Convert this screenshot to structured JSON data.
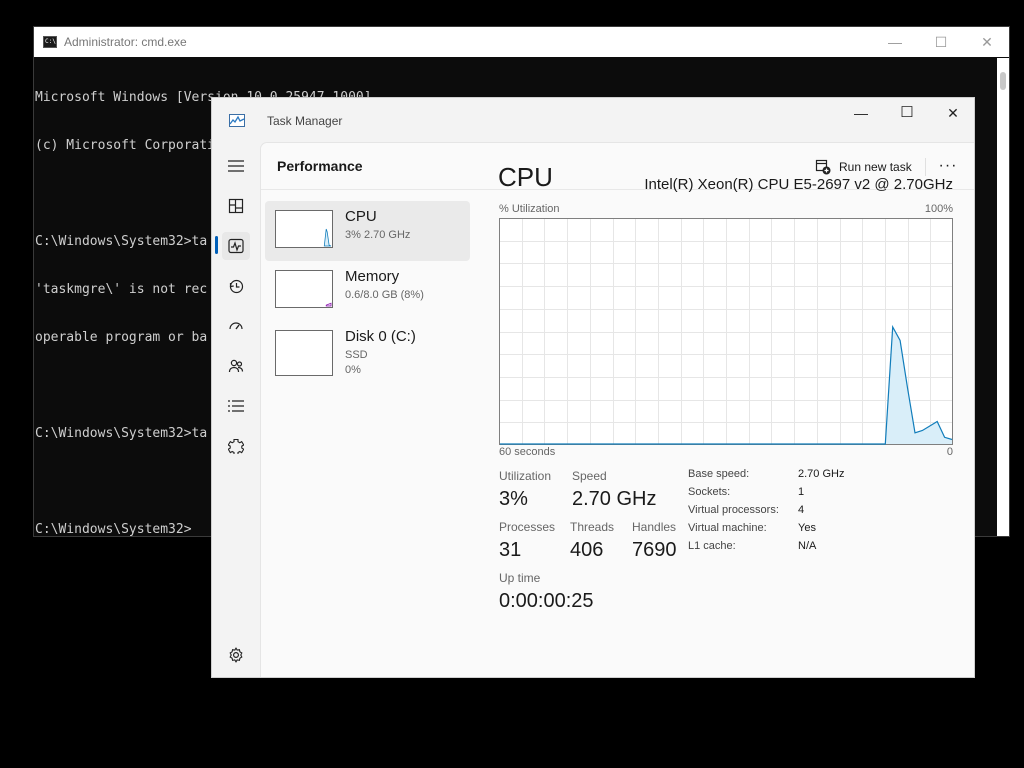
{
  "cmd": {
    "title": "Administrator: cmd.exe",
    "icon_text": "C:\\",
    "controls": {
      "minimize": "—",
      "maximize": "☐",
      "close": "✕"
    },
    "lines": [
      "Microsoft Windows [Version 10.0.25947.1000]",
      "(c) Microsoft Corporation. All rights reserved.",
      "",
      "C:\\Windows\\System32>ta",
      "'taskmgre\\' is not rec",
      "operable program or ba",
      "",
      "C:\\Windows\\System32>ta",
      "",
      "C:\\Windows\\System32>"
    ]
  },
  "taskmanager": {
    "title": "Task Manager",
    "controls": {
      "minimize": "—",
      "maximize": "☐",
      "close": "✕"
    },
    "header": {
      "page_title": "Performance",
      "run_new_task": "Run new task",
      "more": "···"
    },
    "rail": [
      {
        "name": "hamburger-menu-icon",
        "active": false
      },
      {
        "name": "processes-icon",
        "active": false
      },
      {
        "name": "performance-icon",
        "active": true
      },
      {
        "name": "app-history-icon",
        "active": false
      },
      {
        "name": "startup-apps-icon",
        "active": false
      },
      {
        "name": "users-icon",
        "active": false
      },
      {
        "name": "details-icon",
        "active": false
      },
      {
        "name": "services-icon",
        "active": false
      },
      {
        "name": "settings-icon",
        "active": false
      }
    ],
    "side_items": [
      {
        "name": "CPU",
        "sub1": "3% 2.70 GHz",
        "sub2": "",
        "selected": true
      },
      {
        "name": "Memory",
        "sub1": "0.6/8.0 GB (8%)",
        "sub2": "",
        "selected": false
      },
      {
        "name": "Disk 0 (C:)",
        "sub1": "SSD",
        "sub2": "0%",
        "selected": false
      }
    ],
    "cpu": {
      "heading": "CPU",
      "model": "Intel(R) Xeon(R) CPU E5-2697 v2 @ 2.70GHz",
      "graph_ylabel": "% Utilization",
      "graph_ymax": "100%",
      "graph_xlabel": "60 seconds",
      "graph_ymin": "0",
      "utilization_history": [
        0,
        0,
        0,
        0,
        0,
        0,
        0,
        0,
        0,
        0,
        0,
        0,
        0,
        0,
        0,
        0,
        0,
        0,
        0,
        0,
        0,
        0,
        0,
        0,
        0,
        0,
        0,
        0,
        0,
        0,
        0,
        0,
        0,
        0,
        0,
        0,
        0,
        0,
        0,
        0,
        0,
        0,
        0,
        0,
        0,
        0,
        0,
        0,
        0,
        0,
        0,
        0,
        0,
        52,
        46,
        25,
        5,
        6,
        8,
        10,
        3,
        2
      ],
      "stats": {
        "utilization_label": "Utilization",
        "utilization": "3%",
        "speed_label": "Speed",
        "speed": "2.70 GHz",
        "processes_label": "Processes",
        "processes": "31",
        "threads_label": "Threads",
        "threads": "406",
        "handles_label": "Handles",
        "handles": "7690",
        "uptime_label": "Up time",
        "uptime": "0:00:00:25"
      },
      "details": [
        {
          "label": "Base speed:",
          "value": "2.70 GHz"
        },
        {
          "label": "Sockets:",
          "value": "1"
        },
        {
          "label": "Virtual processors:",
          "value": "4"
        },
        {
          "label": "Virtual machine:",
          "value": "Yes"
        },
        {
          "label": "L1 cache:",
          "value": "N/A"
        }
      ]
    },
    "colors": {
      "accent": "#005fb8",
      "graph_line": "#117dbb",
      "graph_fill": "#d9eef9"
    }
  }
}
